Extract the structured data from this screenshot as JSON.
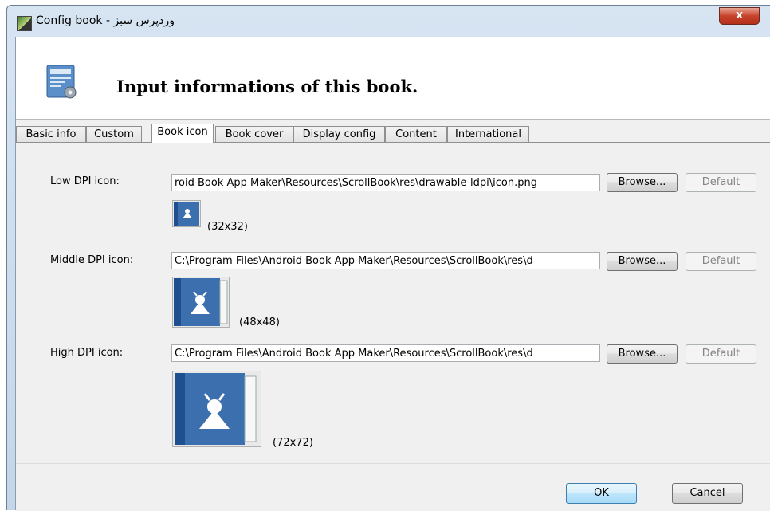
{
  "window": {
    "title": "Config book - وردپرس سبز",
    "close_label": "x"
  },
  "header": {
    "title": "Input informations of this book.",
    "icon": "book-settings-icon"
  },
  "tabs": [
    {
      "label": "Basic info",
      "active": false
    },
    {
      "label": "Custom",
      "active": false
    },
    {
      "label": "Book icon",
      "active": true
    },
    {
      "label": "Book cover",
      "active": false
    },
    {
      "label": "Display config",
      "active": false
    },
    {
      "label": "Content",
      "active": false
    },
    {
      "label": "International",
      "active": false
    }
  ],
  "icons": [
    {
      "label": "Low DPI icon:",
      "path": "roid Book App Maker\\Resources\\ScrollBook\\res\\drawable-ldpi\\icon.png",
      "browse_label": "Browse...",
      "default_label": "Default",
      "size_label": "(32x32)"
    },
    {
      "label": "Middle DPI icon:",
      "path": "C:\\Program Files\\Android Book App Maker\\Resources\\ScrollBook\\res\\d",
      "browse_label": "Browse...",
      "default_label": "Default",
      "size_label": "(48x48)"
    },
    {
      "label": "High DPI icon:",
      "path": "C:\\Program Files\\Android Book App Maker\\Resources\\ScrollBook\\res\\d",
      "browse_label": "Browse...",
      "default_label": "Default",
      "size_label": "(72x72)"
    }
  ],
  "footer": {
    "ok_label": "OK",
    "cancel_label": "Cancel"
  },
  "colors": {
    "icon_blue": "#3c6fae",
    "icon_spine": "#1f4f8f",
    "ok_border": "#3c7fb1"
  }
}
